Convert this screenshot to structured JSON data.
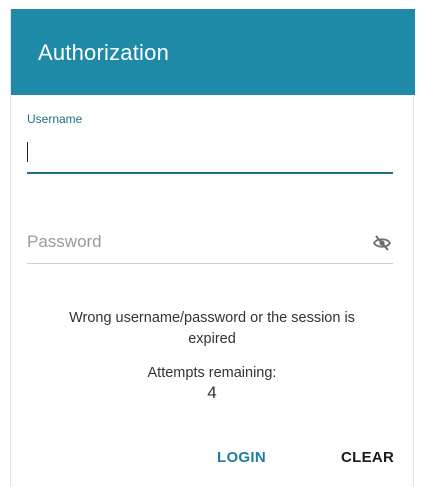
{
  "dialog": {
    "title": "Authorization"
  },
  "username": {
    "label": "Username",
    "value": ""
  },
  "password": {
    "placeholder": "Password",
    "value": "",
    "visibility_icon": "eye-off-icon"
  },
  "message": {
    "line1": "Wrong username/password or the session is",
    "line2": "expired"
  },
  "attempts": {
    "label": "Attempts remaining:",
    "value": "4"
  },
  "buttons": {
    "login": "LOGIN",
    "clear": "CLEAR"
  },
  "colors": {
    "header_bg": "#1e8aa8",
    "accent": "#1e6f88",
    "login_text": "#1e7fa0"
  }
}
